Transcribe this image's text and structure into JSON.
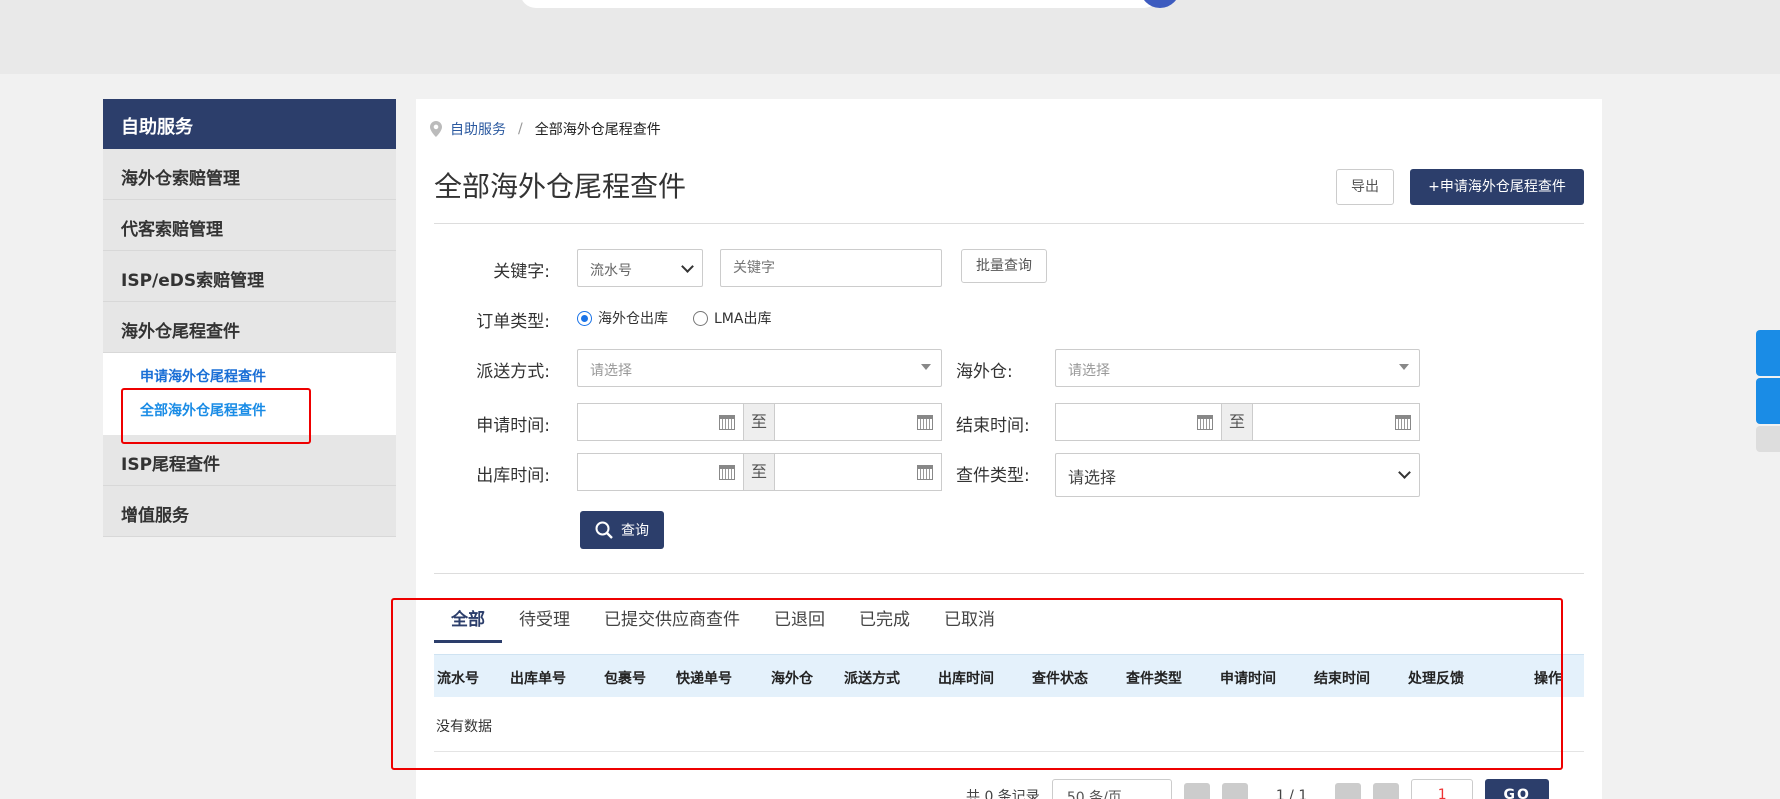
{
  "sidebar": {
    "header": "自助服务",
    "items": [
      {
        "label": "海外仓索赔管理"
      },
      {
        "label": "代客索赔管理"
      },
      {
        "label": "ISP/eDS索赔管理"
      },
      {
        "label": "海外仓尾程查件"
      }
    ],
    "sub_items": [
      {
        "label": "申请海外仓尾程查件"
      },
      {
        "label": "全部海外仓尾程查件"
      }
    ],
    "items_after": [
      {
        "label": "ISP尾程查件"
      },
      {
        "label": "增值服务"
      }
    ]
  },
  "breadcrumb": {
    "root": "自助服务",
    "separator": "/",
    "current": "全部海外仓尾程查件"
  },
  "page": {
    "title": "全部海外仓尾程查件",
    "export_label": "导出",
    "apply_label": "+申请海外仓尾程查件"
  },
  "filters": {
    "keyword_label": "关键字:",
    "keyword_type": "流水号",
    "keyword_placeholder": "关键字",
    "batch_query_label": "批量查询",
    "order_type_label": "订单类型:",
    "order_type_options": [
      "海外仓出库",
      "LMA出库"
    ],
    "order_type_selected": "海外仓出库",
    "delivery_label": "派送方式:",
    "delivery_placeholder": "请选择",
    "warehouse_label": "海外仓:",
    "warehouse_placeholder": "请选择",
    "apply_time_label": "申请时间:",
    "end_time_label": "结束时间:",
    "outbound_time_label": "出库时间:",
    "query_type_label": "查件类型:",
    "query_type_value": "请选择",
    "range_to": "至",
    "query_button": "查询"
  },
  "tabs": [
    "全部",
    "待受理",
    "已提交供应商查件",
    "已退回",
    "已完成",
    "已取消"
  ],
  "active_tab": "全部",
  "table": {
    "columns": [
      "流水号",
      "出库单号",
      "包裹号",
      "快递单号",
      "海外仓",
      "派送方式",
      "出库时间",
      "查件状态",
      "查件类型",
      "申请时间",
      "结束时间",
      "处理反馈",
      "操作"
    ],
    "empty_text": "没有数据"
  },
  "pager": {
    "total": "共 0 条记录",
    "page_size": "50 条/页",
    "page_info": "1 / 1",
    "page_input": "1",
    "go": "GO"
  },
  "colors": {
    "primary": "#2c3e6b",
    "link": "#1a6fd6",
    "highlight": "#e00000",
    "table_header": "#e4f1fb"
  }
}
